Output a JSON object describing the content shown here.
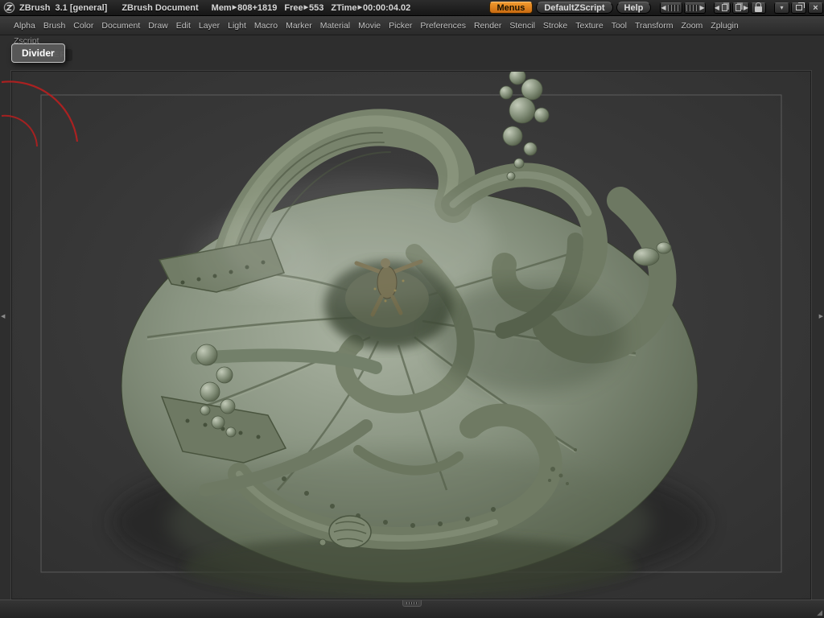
{
  "colors": {
    "accent_orange": "#e8881e",
    "titlebar_bg": "#1c1c1c",
    "menubar_bg": "#333333",
    "workspace_bg": "#2e2e2e",
    "canvas_bg": "#383838",
    "sculpt_base_light": "#a8b2a0",
    "sculpt_base_mid": "#87927f",
    "sculpt_base_dark": "#47523f",
    "red_arc": "#b81f1f",
    "frame_line": "#8f8f8f"
  },
  "titlebar": {
    "app_name": "ZBrush",
    "version": "3.1 [general]",
    "document_title": "ZBrush Document",
    "stats": [
      {
        "label": "Mem",
        "value": "808+1819"
      },
      {
        "label": "Free",
        "value": "553"
      },
      {
        "label": "ZTime",
        "value": "00:00:04.02"
      }
    ],
    "menus_button": "Menus",
    "zscript_button": "DefaultZScript",
    "help_button": "Help"
  },
  "menubar": {
    "items": [
      "Alpha",
      "Brush",
      "Color",
      "Document",
      "Draw",
      "Edit",
      "Layer",
      "Light",
      "Macro",
      "Marker",
      "Material",
      "Movie",
      "Picker",
      "Preferences",
      "Render",
      "Stencil",
      "Stroke",
      "Texture",
      "Tool",
      "Transform",
      "Zoom",
      "Zplugin"
    ],
    "wrapped_item": "Zscript"
  },
  "workspace": {
    "divider_label": "DIVIDER",
    "divider_tooltip": "Divider"
  },
  "icons": {
    "stat_sep": "▶",
    "left_arrow": "◀",
    "right_arrow": "▶",
    "chevron_down": "▾",
    "close": "×",
    "edge_left": "◀",
    "edge_right": "▶",
    "resize_grip": "◢"
  }
}
